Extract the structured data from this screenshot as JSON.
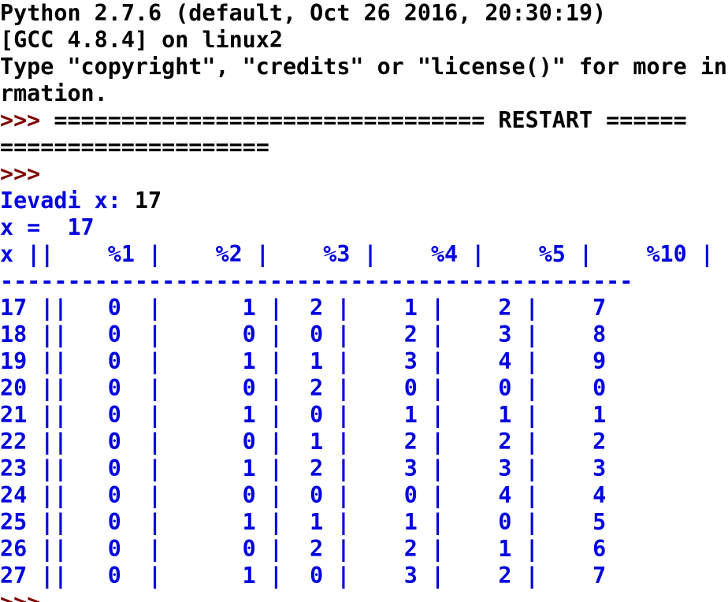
{
  "colors": {
    "background": "#ffffff",
    "stdout_text": "#000000",
    "program_output": "#0000e0",
    "prompt": "#800000"
  },
  "banner": [
    "Python 2.7.6 (default, Oct 26 2016, 20:30:19)",
    "[GCC 4.8.4] on linux2",
    "Type \"copyright\", \"credits\" or \"license()\" for more info",
    "rmation."
  ],
  "prompt": ">>>",
  "restart_line": " ================================ RESTART ======",
  "restart_line_cont": "====================",
  "input_prompt": "Ievadi x:",
  "input_value": " 17",
  "echo_line": "x =  17",
  "table_header": "x ||    %1 |    %2 |    %3 |    %4 |    %5 |    %10 |",
  "table_separator": "-----------------------------------------------",
  "table_rows": [
    "17 ||   0  |      1 |  2 |    1 |    2 |    7",
    "18 ||   0  |      0 |  0 |    2 |    3 |    8",
    "19 ||   0  |      1 |  1 |    3 |    4 |    9",
    "20 ||   0  |      0 |  2 |    0 |    0 |    0",
    "21 ||   0  |      1 |  0 |    1 |    1 |    1",
    "22 ||   0  |      0 |  1 |    2 |    2 |    2",
    "23 ||   0  |      1 |  2 |    3 |    3 |    3",
    "24 ||   0  |      0 |  0 |    0 |    4 |    4",
    "25 ||   0  |      1 |  1 |    1 |    0 |    5",
    "26 ||   0  |      0 |  2 |    2 |    1 |    6",
    "27 ||   0  |      1 |  0 |    3 |    2 |    7"
  ]
}
